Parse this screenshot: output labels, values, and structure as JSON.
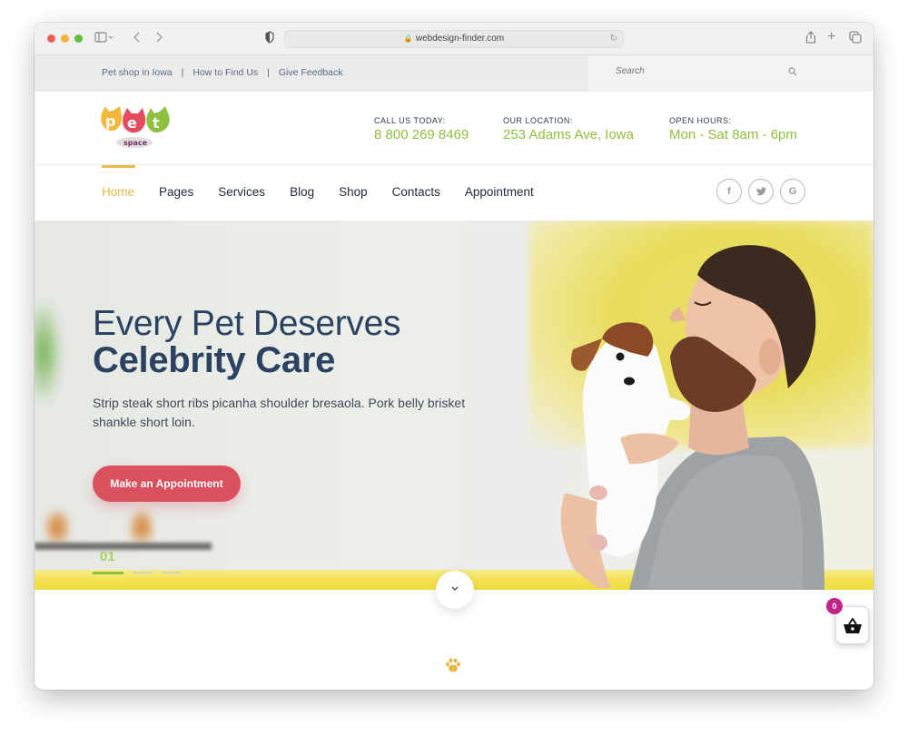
{
  "browser": {
    "url": "webdesign-finder.com",
    "traffic_colors": [
      "#ec5f57",
      "#f3b43d",
      "#5ec145"
    ]
  },
  "topbar": {
    "links": [
      "Pet shop in Iowa",
      "How to Find Us",
      "Give Feedback"
    ],
    "separator": "|",
    "search_placeholder": "Search"
  },
  "header": {
    "logo_text": "pet",
    "logo_sub": "space",
    "info": [
      {
        "label": "CALL US TODAY:",
        "value": "8 800 269 8469"
      },
      {
        "label": "OUR LOCATION:",
        "value": "253 Adams Ave, Iowa"
      },
      {
        "label": "OPEN HOURS:",
        "value": "Mon - Sat 8am - 6pm"
      }
    ]
  },
  "nav": {
    "items": [
      "Home",
      "Pages",
      "Services",
      "Blog",
      "Shop",
      "Contacts",
      "Appointment"
    ],
    "active": "Home",
    "social": [
      {
        "icon": "facebook-icon",
        "glyph": "f"
      },
      {
        "icon": "twitter-icon",
        "glyph": "🐦"
      },
      {
        "icon": "google-icon",
        "glyph": "G"
      }
    ]
  },
  "hero": {
    "title_line1": "Every Pet Deserves",
    "title_line2": "Celebrity Care",
    "text": "Strip steak short ribs picanha shoulder bresaola. Pork belly brisket shankle short loin.",
    "cta_label": "Make an Appointment",
    "slide_number": "01",
    "slide_count": 3,
    "active_slide": 1
  },
  "cart": {
    "count": "0"
  },
  "colors": {
    "accent_yellow": "#e9b949",
    "green": "#8dc03f",
    "cta_red": "#d9505f",
    "navy": "#2b4360",
    "badge": "#c2238b"
  }
}
